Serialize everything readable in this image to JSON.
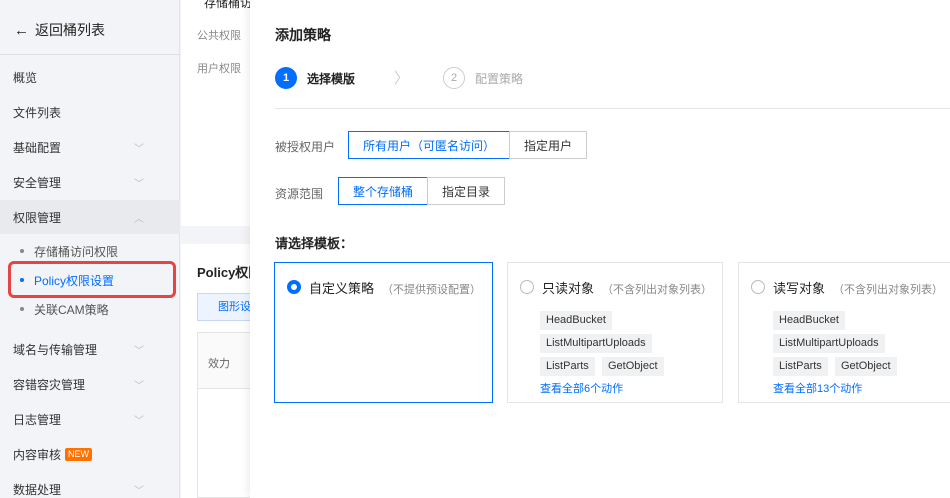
{
  "sidebar": {
    "back_label": "返回桶列表",
    "items": [
      {
        "label": "概览"
      },
      {
        "label": "文件列表"
      },
      {
        "label": "基础配置"
      },
      {
        "label": "安全管理"
      },
      {
        "label": "权限管理"
      },
      {
        "label": "域名与传输管理"
      },
      {
        "label": "容错容灾管理"
      },
      {
        "label": "日志管理"
      },
      {
        "label": "内容审核",
        "badge": "NEW"
      },
      {
        "label": "数据处理"
      }
    ],
    "sub_items": [
      {
        "label": "存储桶访问权限"
      },
      {
        "label": "Policy权限设置"
      },
      {
        "label": "关联CAM策略"
      }
    ]
  },
  "background": {
    "top_cut_text": "存储桶访",
    "public_perm": "公共权限",
    "user_perm": "用户权限",
    "policy_title": "Policy权限",
    "graph_btn": "图形设置",
    "effect_col": "效力"
  },
  "drawer": {
    "title": "添加策略",
    "steps": [
      {
        "num": "1",
        "label": "选择模版"
      },
      {
        "num": "2",
        "label": "配置策略"
      }
    ],
    "step_separator": "〉",
    "grantee_label": "被授权用户",
    "grantee_options": [
      "所有用户（可匿名访问）",
      "指定用户"
    ],
    "resource_label": "资源范围",
    "resource_options": [
      "整个存储桶",
      "指定目录"
    ],
    "template_label": "请选择模板：",
    "templates": [
      {
        "name": "自定义策略",
        "desc": "（不提供预设配置）",
        "tags": [],
        "view_all": ""
      },
      {
        "name": "只读对象",
        "desc": "（不含列出对象列表）",
        "tags": [
          "HeadBucket",
          "ListMultipartUploads",
          "ListParts",
          "GetObject"
        ],
        "view_all": "查看全部6个动作"
      },
      {
        "name": "读写对象",
        "desc": "（不含列出对象列表）",
        "tags": [
          "HeadBucket",
          "ListMultipartUploads",
          "ListParts",
          "GetObject"
        ],
        "view_all": "查看全部13个动作"
      }
    ]
  },
  "colors": {
    "accent": "#006eff",
    "highlight": "#e54545",
    "badge": "#ff7200"
  }
}
